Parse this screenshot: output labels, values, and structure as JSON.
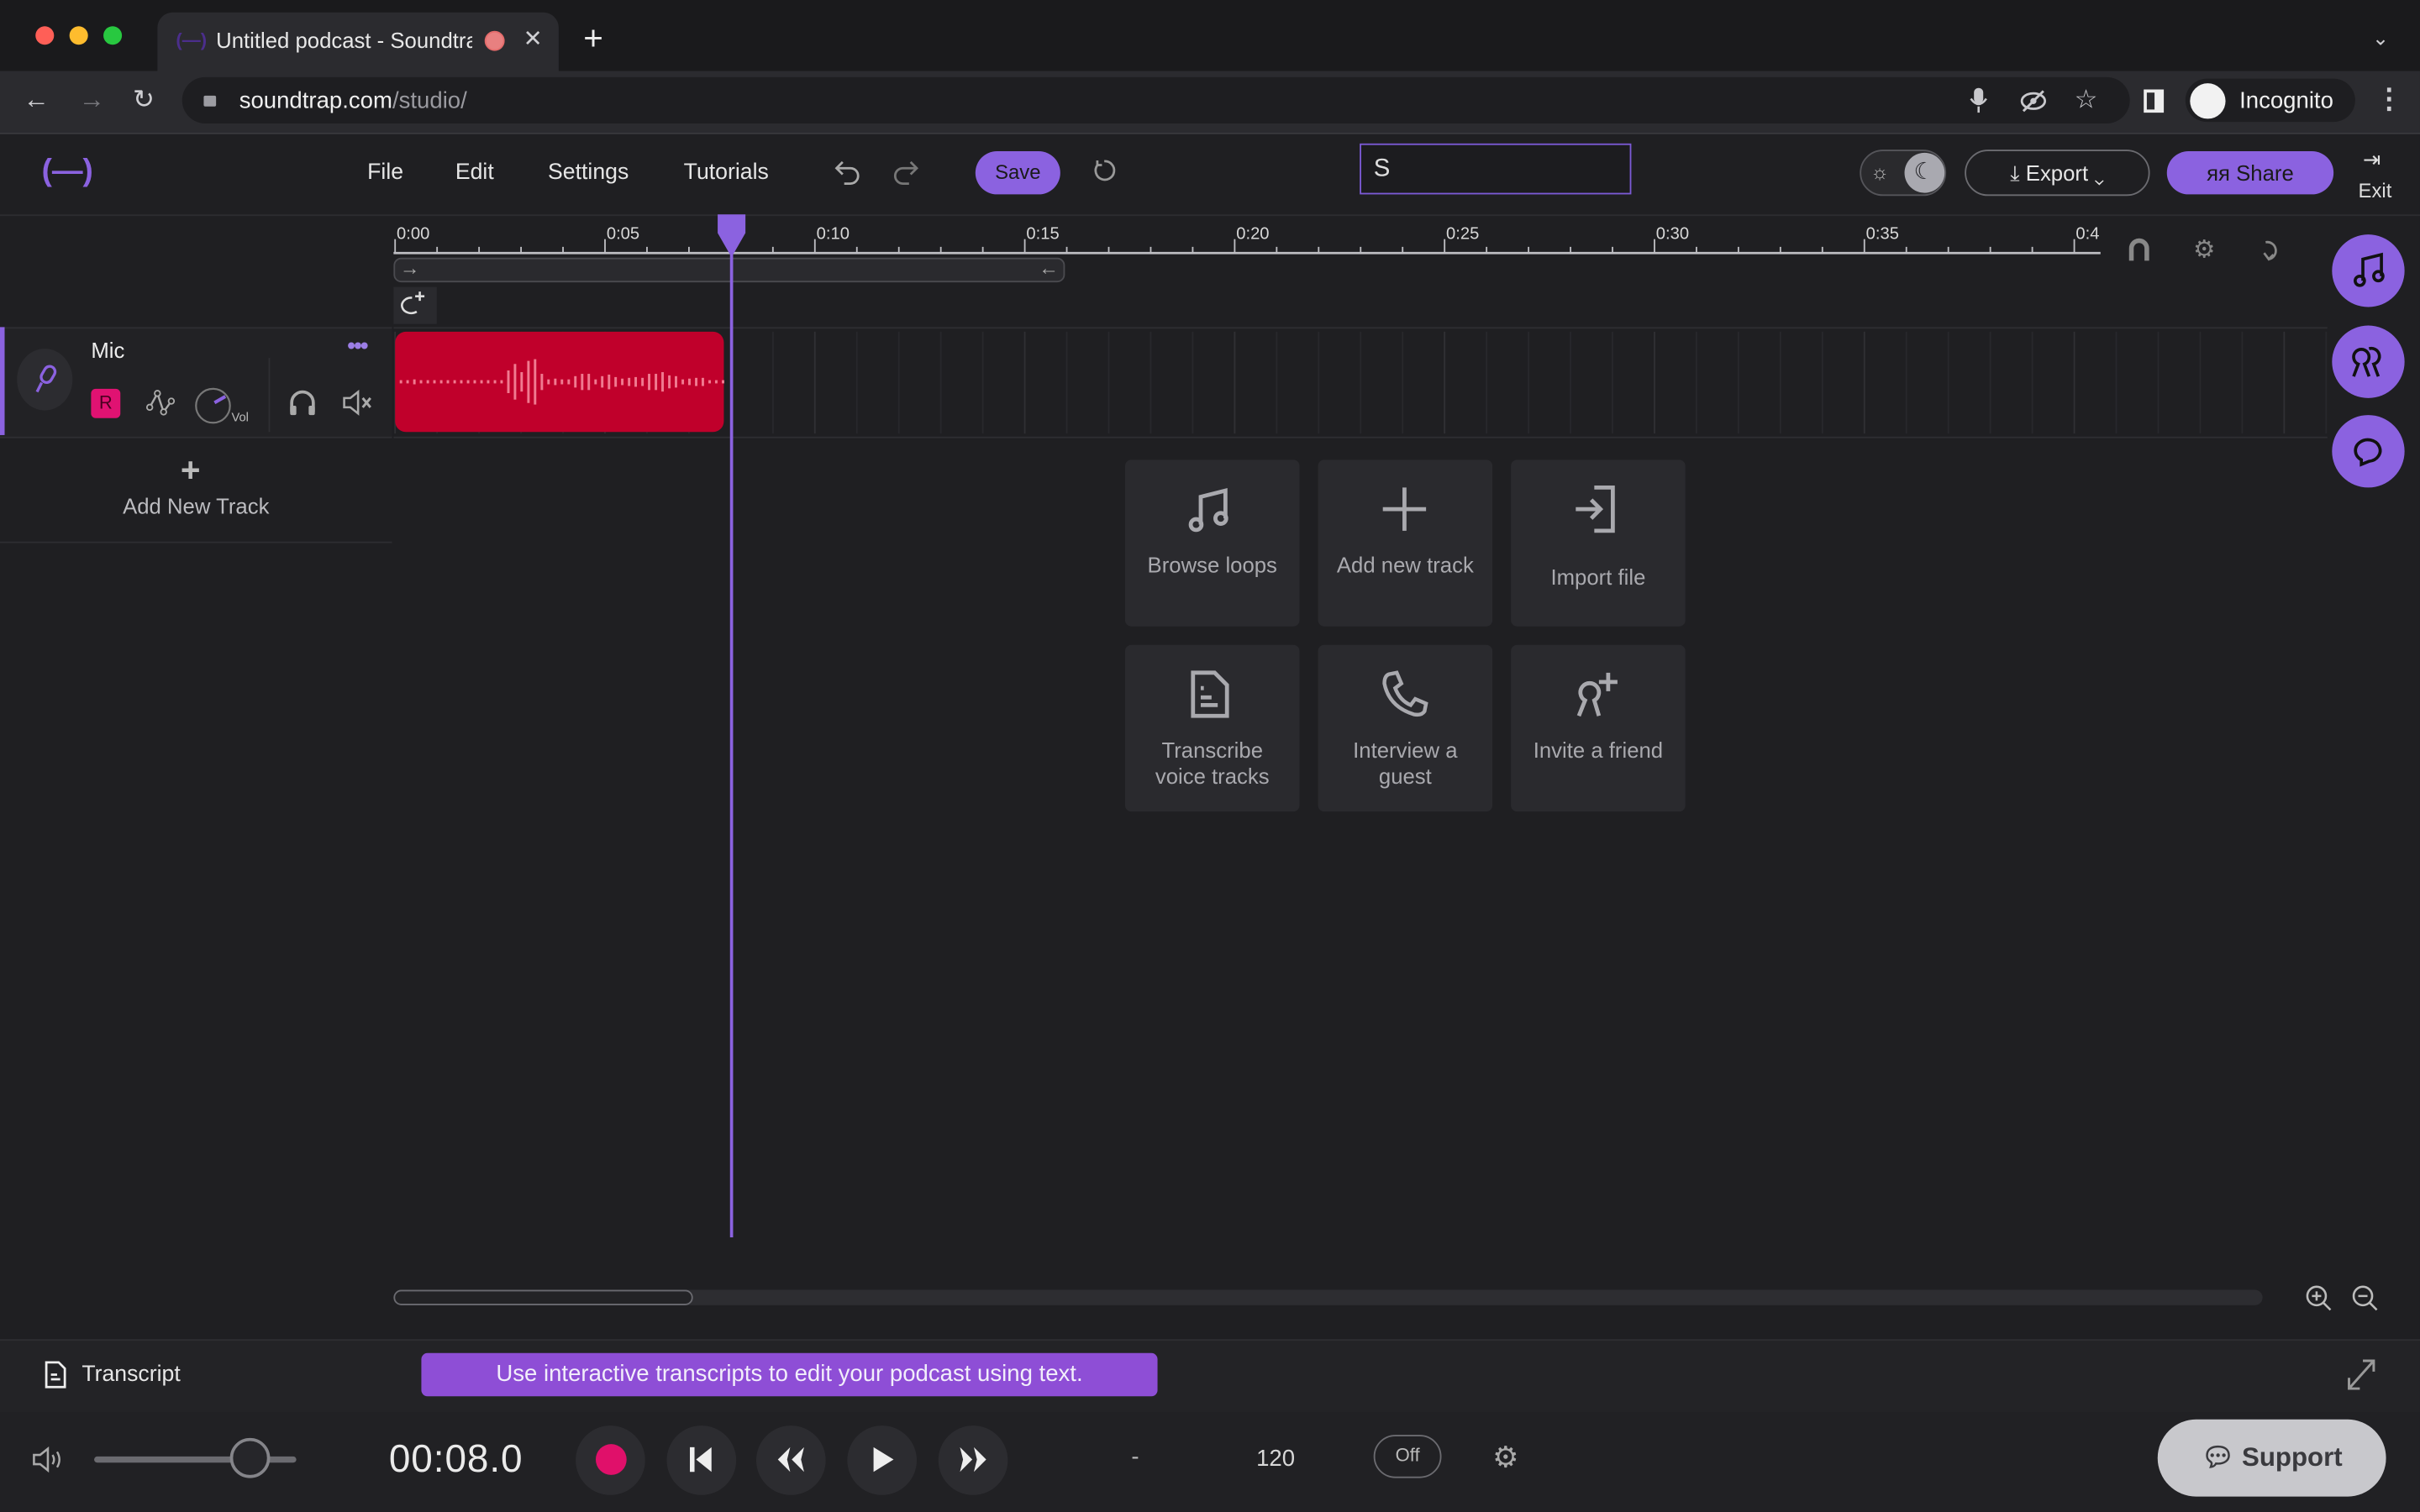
{
  "browser": {
    "tab_title": "Untitled podcast - Soundtrap",
    "url_host": "soundtrap.com",
    "url_path": "/studio/",
    "profile_label": "Incognito"
  },
  "app": {
    "menu": [
      "File",
      "Edit",
      "Settings",
      "Tutorials"
    ],
    "save_label": "Save",
    "search_value": "S",
    "export_label": "Export",
    "share_label": "Share",
    "exit_label": "Exit",
    "accent_color": "#8b62e0"
  },
  "timeline": {
    "ticks": [
      "0:00",
      "0:05",
      "0:10",
      "0:15",
      "0:20",
      "0:25",
      "0:30",
      "0:35",
      "0:4"
    ],
    "playhead_seconds": 8.0
  },
  "track": {
    "name": "Mic",
    "record_label": "R",
    "vol_label": "Vol",
    "clip_color": "#c0002b"
  },
  "add_track_label": "Add New Track",
  "actions": [
    {
      "icon": "music-note-icon",
      "label": "Browse loops"
    },
    {
      "icon": "plus-icon",
      "label": "Add new track"
    },
    {
      "icon": "import-icon",
      "label": "Import file"
    },
    {
      "icon": "document-icon",
      "label": "Transcribe voice tracks"
    },
    {
      "icon": "phone-icon",
      "label": "Interview a guest"
    },
    {
      "icon": "add-user-icon",
      "label": "Invite a friend"
    }
  ],
  "transcript": {
    "label": "Transcript",
    "tip": "Use interactive transcripts to edit your podcast using text."
  },
  "transport": {
    "time": "00:08.0",
    "key": "-",
    "tempo": "120",
    "metronome": "Off",
    "volume_fraction": 0.77,
    "support_label": "Support"
  }
}
